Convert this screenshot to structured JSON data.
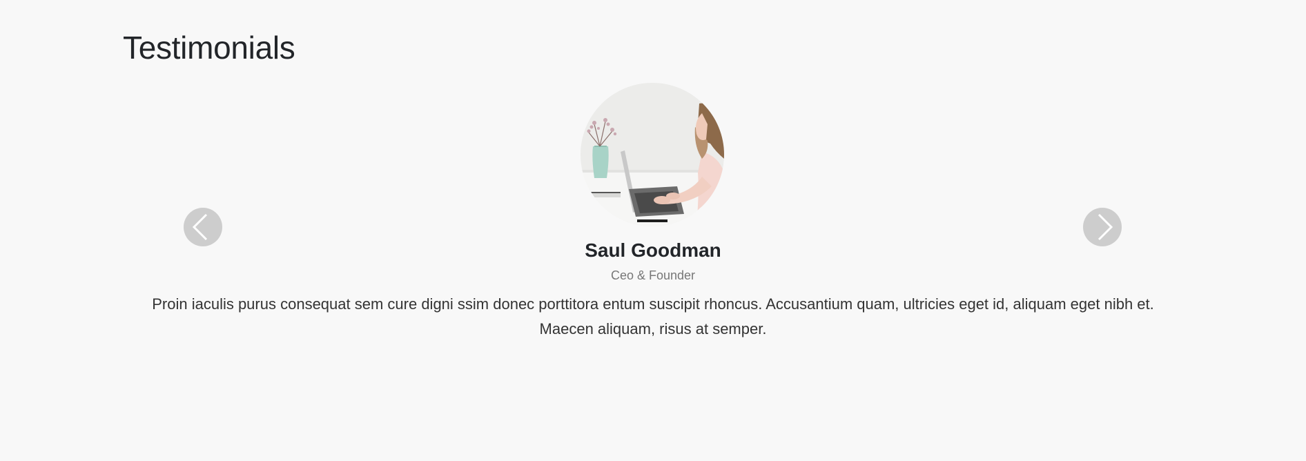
{
  "section": {
    "title": "Testimonials"
  },
  "testimonial": {
    "name": "Saul Goodman",
    "role": "Ceo & Founder",
    "quote": "Proin iaculis purus consequat sem cure digni ssim donec porttitora entum suscipit rhoncus. Accusantium quam, ultricies eget id, aliquam eget nibh et. Maecen aliquam, risus at semper.",
    "avatar_alt": "woman typing on laptop at white desk"
  },
  "carousel": {
    "prev_icon": "chevron-left-icon",
    "next_icon": "chevron-right-icon",
    "button_color": "#cdcdcd"
  },
  "colors": {
    "background": "#f8f8f8",
    "heading": "#222529",
    "muted": "#777777",
    "body_text": "#333333"
  }
}
